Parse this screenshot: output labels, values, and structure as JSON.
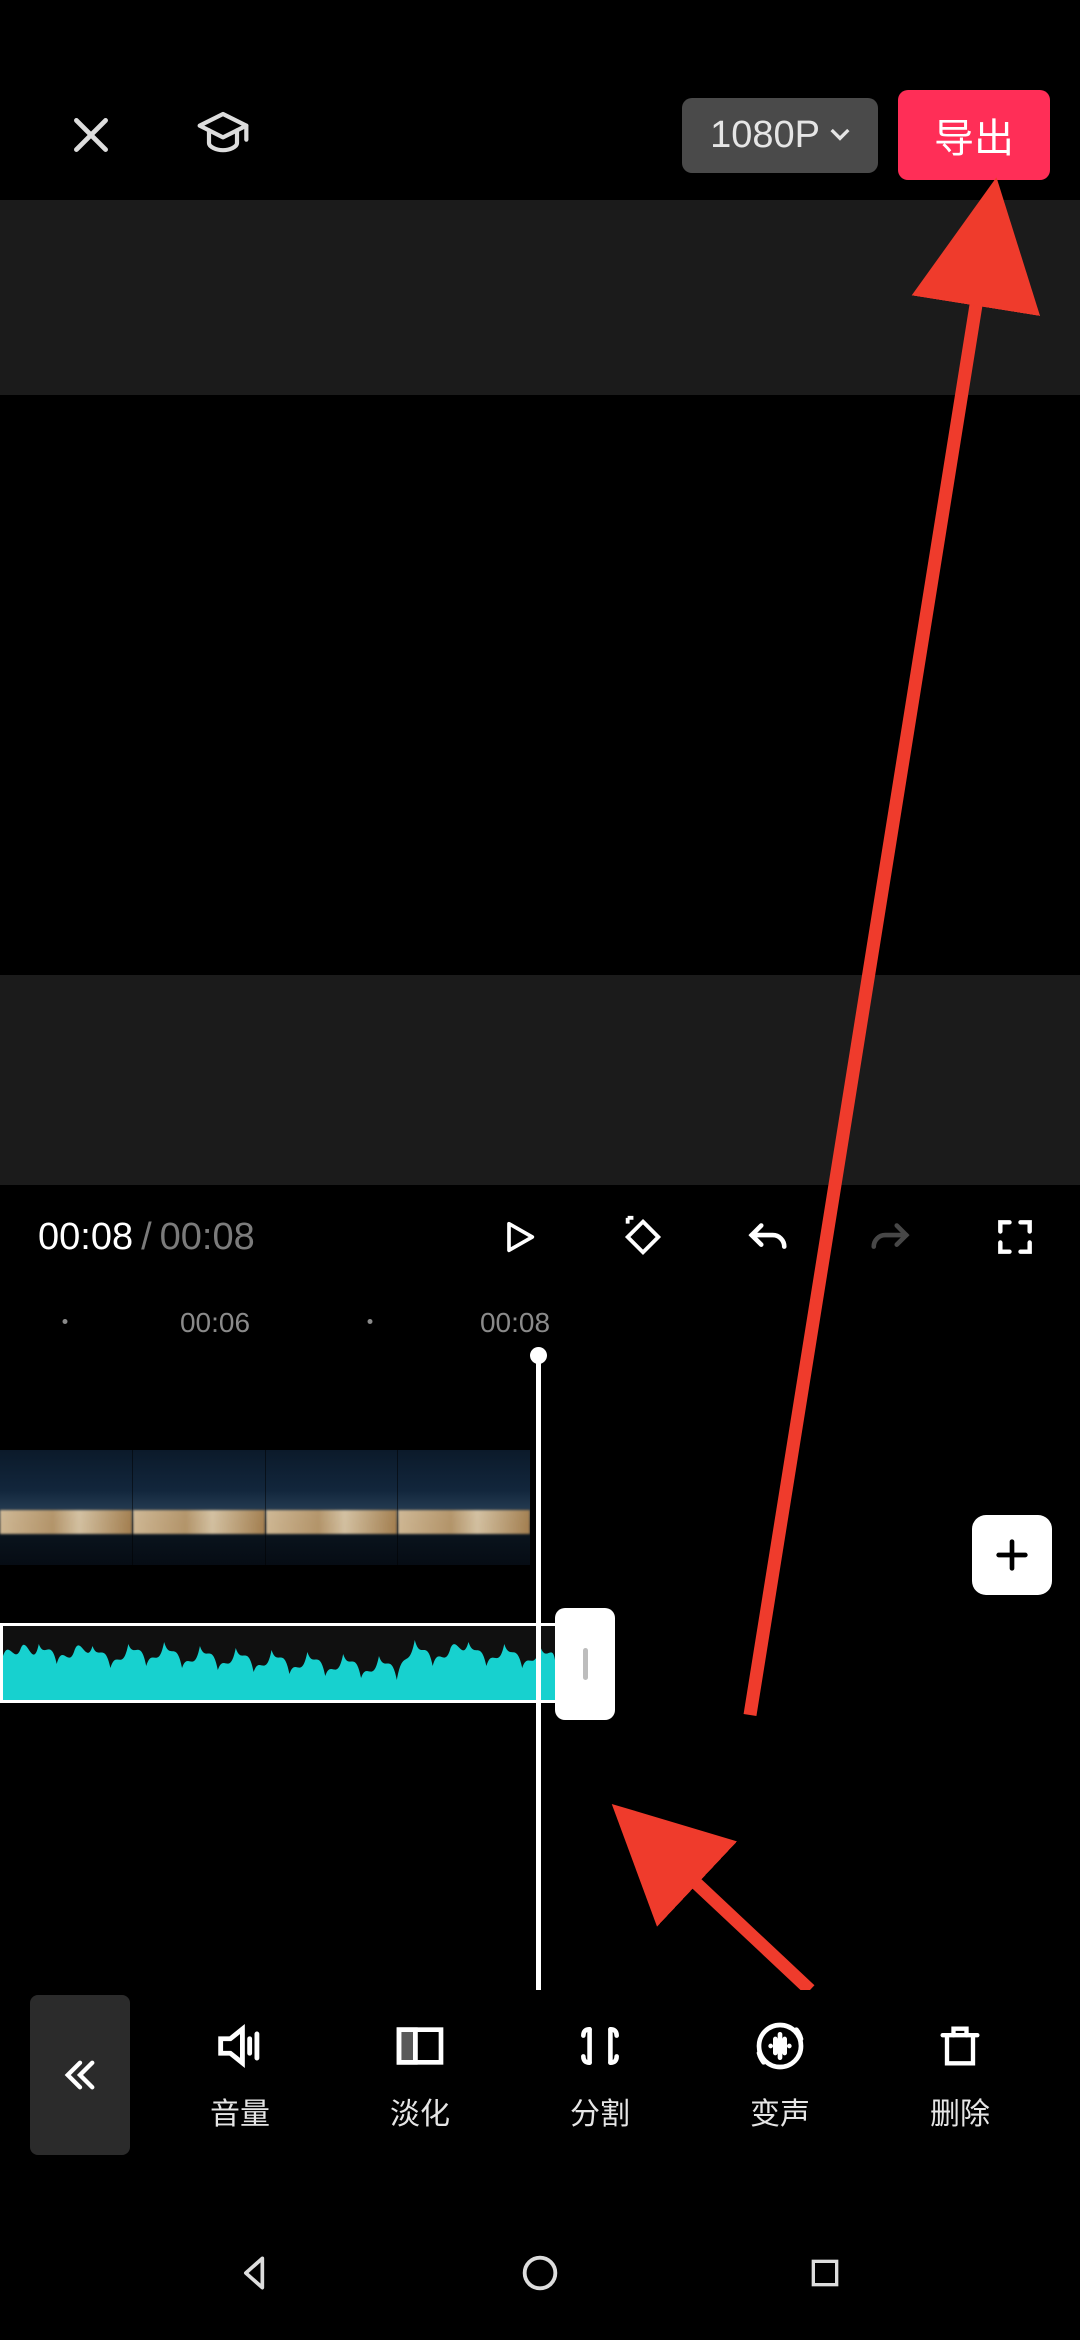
{
  "topbar": {
    "resolution_label": "1080P",
    "export_label": "导出"
  },
  "playback": {
    "current_time": "00:08",
    "separator": "/",
    "duration": "00:08"
  },
  "timeline": {
    "ruler_labels": [
      "00:06",
      "00:08"
    ]
  },
  "toolbar": {
    "items": [
      {
        "name": "volume",
        "label": "音量"
      },
      {
        "name": "fade",
        "label": "淡化"
      },
      {
        "name": "split",
        "label": "分割"
      },
      {
        "name": "voicechange",
        "label": "变声"
      },
      {
        "name": "delete",
        "label": "删除"
      }
    ]
  },
  "colors": {
    "accent": "#ff2e57",
    "waveform": "#17d1cf"
  }
}
